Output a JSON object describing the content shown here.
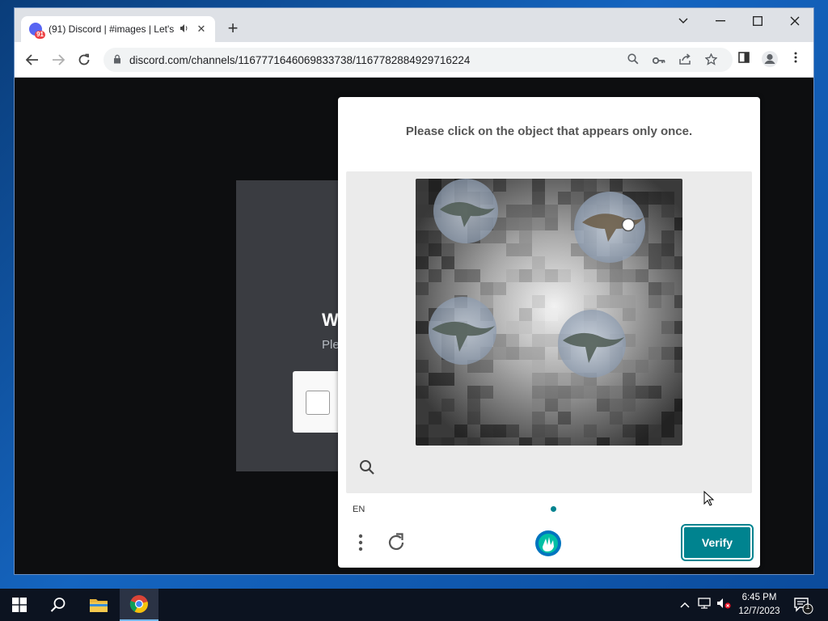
{
  "browser": {
    "tab": {
      "badge": "91",
      "title": "(91) Discord | #images | Let's",
      "sound_icon": "speaker-icon",
      "close": "✕"
    },
    "new_tab": "+",
    "window_controls": {
      "chevron": "⌄",
      "minimize": "—",
      "maximize": "☐",
      "close": "✕"
    },
    "nav": {
      "back": "←",
      "forward": "→",
      "reload": "↻"
    },
    "url": "discord.com/channels/1167771646069833738/1167782884929716224",
    "omnibox_icons": [
      "search-icon",
      "key-icon",
      "share-icon",
      "star-icon"
    ],
    "toolbar_icons": [
      "side-panel-icon",
      "profile-icon",
      "menu-icon"
    ]
  },
  "discord": {
    "heading": "W",
    "subtext": "Ple"
  },
  "captcha": {
    "prompt": "Please click on the object that appears only once.",
    "language": "EN",
    "verify_label": "Verify",
    "accent_color": "#00838f"
  },
  "taskbar": {
    "clock_time": "6:45 PM",
    "clock_date": "12/7/2023",
    "notification_count": "1"
  }
}
